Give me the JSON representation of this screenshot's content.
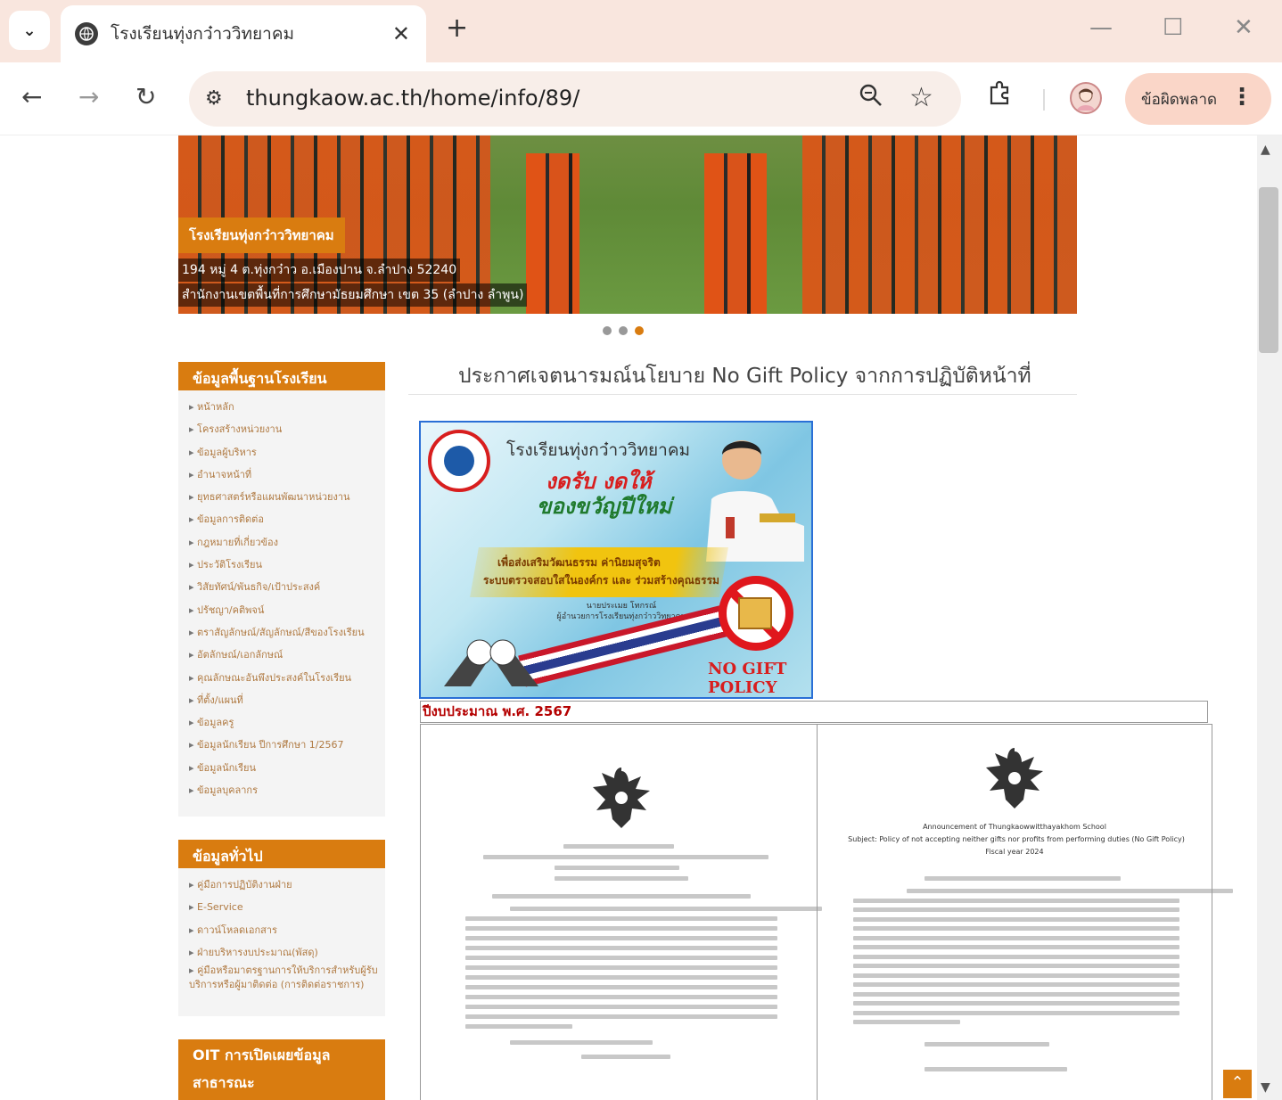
{
  "browser": {
    "tab_title": "โรงเรียนทุ่งกว๋าววิทยาคม",
    "url": "thungkaow.ac.th/home/info/89/",
    "error_button_label": "ข้อผิดพลาด"
  },
  "banner": {
    "school_name": "โรงเรียนทุ่งกว๋าววิทยาคม",
    "address_line1": "194 หมู่ 4 ต.ทุ่งกว๋าว อ.เมืองปาน จ.ลำปาง 52240",
    "address_line2": "สำนักงานเขตพื้นที่การศึกษามัธยมศึกษา เขต 35 (ลำปาง ลำพูน)",
    "slides_count": 3,
    "active_slide": 3
  },
  "sidebar": {
    "basic_info": {
      "heading": "ข้อมูลพื้นฐานโรงเรียน",
      "items": [
        "หน้าหลัก",
        "โครงสร้างหน่วยงาน",
        "ข้อมูลผู้บริหาร",
        "อำนาจหน้าที่",
        "ยุทธศาสตร์หรือแผนพัฒนาหน่วยงาน",
        "ข้อมูลการติดต่อ",
        "กฎหมายที่เกี่ยวข้อง",
        "ประวัติโรงเรียน",
        "วิสัยทัศน์/พันธกิจ/เป้าประสงค์",
        "ปรัชญา/คติพจน์",
        "ตราสัญลักษณ์/สัญลักษณ์/สีของโรงเรียน",
        "อัตลักษณ์/เอกลักษณ์",
        "คุณลักษณะอันพึงประสงค์ในโรงเรียน",
        "ที่ตั้ง/แผนที่",
        "ข้อมูลครู",
        "ข้อมูลนักเรียน ปีการศึกษา 1/2567",
        "ข้อมูลนักเรียน",
        "ข้อมูลบุคลากร"
      ]
    },
    "general": {
      "heading": "ข้อมูลทั่วไป",
      "items": [
        "คู่มือการปฏิบัติงานฝ่าย",
        "E-Service",
        "ดาวน์โหลดเอกสาร",
        "ฝ่ายบริหารงบประมาณ(พัสดุ)",
        "คู่มือหรือมาตรฐานการให้บริการสำหรับผู้รับบริการหรือผู้มาติดต่อ (การติดต่อราชการ)"
      ]
    },
    "oit": {
      "heading_line1": "OIT การเปิดเผยข้อมูล",
      "heading_line2": "สาธารณะ"
    }
  },
  "main": {
    "title": "ประกาศเจตนารมณ์นโยบาย No Gift Policy จากการปฏิบัติหน้าที่",
    "poster": {
      "school": "โรงเรียนทุ่งกว๋าววิทยาคม",
      "headline_red": "งดรับ งดให้",
      "headline_green": "ของขวัญปีใหม่",
      "sub_line1": "เพื่อส่งเสริมวัฒนธรรม ค่านิยมสุจริต",
      "sub_line2": "ระบบตรวจสอบใสในองค์กร และ ร่วมสร้างคุณธรรม",
      "director_name": "นายประเมย โทกรณ์",
      "director_title": "ผู้อำนวยการโรงเรียนทุ่งกว๋าววิทยาคม",
      "no_gift_label": "NO GIFT POLICY"
    },
    "budget_label": "ปีงบประมาณ พ.ศ. 2567",
    "doc_en": {
      "title_line1": "Announcement of Thungkaowwitthayakhom School",
      "title_line2": "Subject: Policy of not accepting neither gifts nor profits from performing duties (No Gift Policy)",
      "title_line3": "Fiscal year 2024"
    }
  },
  "colors": {
    "accent": "#d97c10",
    "tab_bar": "#f9e6de",
    "budget_text": "#b40000"
  }
}
